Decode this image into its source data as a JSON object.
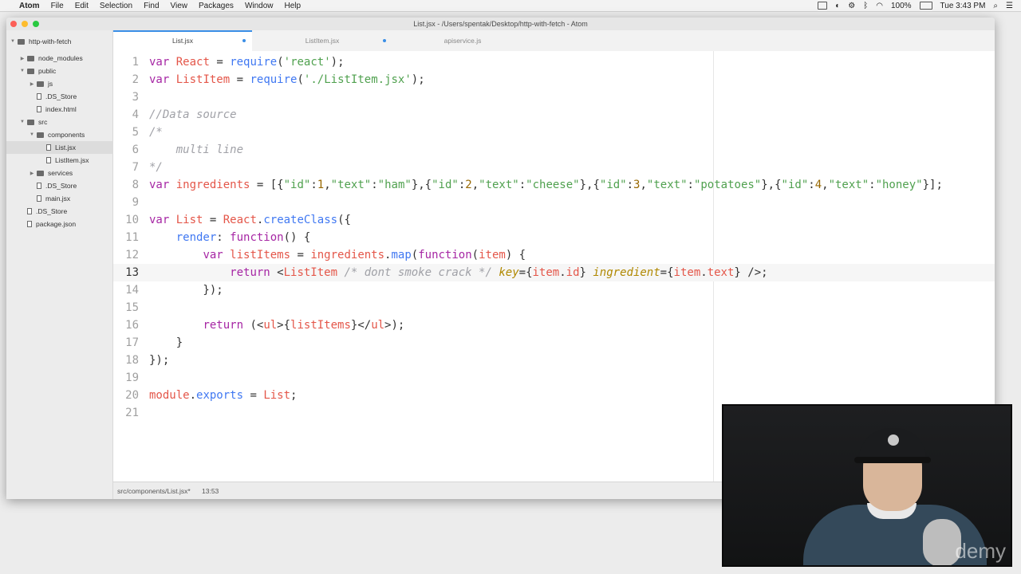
{
  "menubar": {
    "app": "Atom",
    "items": [
      "File",
      "Edit",
      "Selection",
      "Find",
      "View",
      "Packages",
      "Window",
      "Help"
    ],
    "battery": "100%",
    "clock": "Tue 3:43 PM"
  },
  "window": {
    "title": "List.jsx - /Users/spentak/Desktop/http-with-fetch - Atom"
  },
  "tree": [
    {
      "label": "http-with-fetch",
      "kind": "folder"
    },
    {
      "label": "node_modules",
      "kind": "folder"
    },
    {
      "label": "public",
      "kind": "folder"
    },
    {
      "label": "js",
      "kind": "folder"
    },
    {
      "label": ".DS_Store",
      "kind": "file"
    },
    {
      "label": "index.html",
      "kind": "file"
    },
    {
      "label": "src",
      "kind": "folder"
    },
    {
      "label": "components",
      "kind": "folder"
    },
    {
      "label": "List.jsx",
      "kind": "file"
    },
    {
      "label": "ListItem.jsx",
      "kind": "file"
    },
    {
      "label": "services",
      "kind": "folder"
    },
    {
      "label": ".DS_Store",
      "kind": "file"
    },
    {
      "label": "main.jsx",
      "kind": "file"
    },
    {
      "label": ".DS_Store",
      "kind": "file"
    },
    {
      "label": "package.json",
      "kind": "file"
    }
  ],
  "tabs": [
    {
      "label": "List.jsx",
      "active": true,
      "modified": true
    },
    {
      "label": "ListItem.jsx",
      "active": false,
      "modified": true
    },
    {
      "label": "apiservice.js",
      "active": false,
      "modified": false
    }
  ],
  "editor": {
    "current_line": 13,
    "lines": [
      {
        "num": "1"
      },
      {
        "num": "2"
      },
      {
        "num": "3"
      },
      {
        "num": "4"
      },
      {
        "num": "5"
      },
      {
        "num": "6"
      },
      {
        "num": "7"
      },
      {
        "num": "8"
      },
      {
        "num": "9"
      },
      {
        "num": "10"
      },
      {
        "num": "11"
      },
      {
        "num": "12"
      },
      {
        "num": "13"
      },
      {
        "num": "14"
      },
      {
        "num": "15"
      },
      {
        "num": "16"
      },
      {
        "num": "17"
      },
      {
        "num": "18"
      },
      {
        "num": "19"
      },
      {
        "num": "20"
      },
      {
        "num": "21"
      }
    ]
  },
  "status": {
    "path": "src/components/List.jsx*",
    "cursor": "13:53"
  },
  "webcam": {
    "watermark": "demy"
  },
  "colors": {
    "keyword": "#a626a4",
    "string": "#50a14f",
    "variable": "#e45649",
    "function": "#4078f2",
    "comment": "#a0a1a7",
    "number": "#986801",
    "accent": "#3a8ee6"
  }
}
